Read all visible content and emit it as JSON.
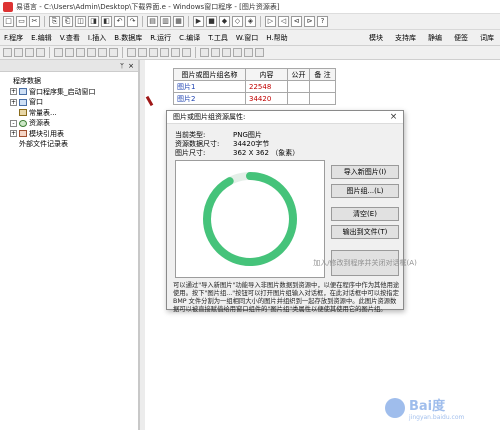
{
  "window": {
    "title": "易语言 - C:\\Users\\Admin\\Desktop\\下载界面.e - Windows窗口程序 - [图片资源表]"
  },
  "toolbar1": {
    "buttons": [
      "□",
      "▭",
      "✂",
      "⎘",
      "⎗",
      "◫",
      "◨",
      "◧",
      "↶",
      "↷",
      "▤",
      "▥",
      "▦",
      "▶",
      "■",
      "◆",
      "◇",
      "◈",
      "▷",
      "◁",
      "⊲",
      "⊳",
      "?"
    ]
  },
  "menubar": {
    "left": [
      "F.程序",
      "E.编辑",
      "V.查看",
      "I.插入",
      "B.数据库",
      "R.运行",
      "C.编译",
      "T.工具",
      "W.窗口",
      "H.帮助"
    ],
    "right": [
      "模块",
      "支持库",
      "静编",
      "便签",
      "词库"
    ]
  },
  "leftpanel": {
    "pin_label": "ᛘ",
    "close_label": "×",
    "tree": [
      {
        "label": "程序数据",
        "expander": "",
        "icon": "",
        "indent": 0
      },
      {
        "label": "窗口程序集_启动窗口",
        "expander": "+",
        "icon": "win",
        "indent": 1
      },
      {
        "label": "窗口",
        "expander": "+",
        "icon": "win",
        "indent": 1
      },
      {
        "label": "常量表...",
        "expander": "",
        "icon": "db",
        "indent": 1
      },
      {
        "label": "资源表",
        "expander": "-",
        "icon": "res",
        "indent": 1
      },
      {
        "label": "模块引用表",
        "expander": "+",
        "icon": "mod",
        "indent": 1
      },
      {
        "label": "外部文件记录表",
        "expander": "",
        "icon": "",
        "indent": 1
      }
    ]
  },
  "resource_table": {
    "headers": [
      "图片或图片组名称",
      "内容",
      "公开",
      "备 注"
    ],
    "rows": [
      {
        "name": "图片1",
        "content": "22548",
        "public": "",
        "note": ""
      },
      {
        "name": "图片2",
        "content": "34420",
        "public": "",
        "note": ""
      }
    ]
  },
  "dialog": {
    "title": "图片或图片组资源属性:",
    "close": "×",
    "info": [
      {
        "label": "当前类型:",
        "value": "PNG图片"
      },
      {
        "label": "资源数据尺寸:",
        "value": "34420字节"
      },
      {
        "label": "图片尺寸:",
        "value": "362 X 362 （象素）"
      }
    ],
    "buttons": {
      "import": "导入新图片(I)",
      "group": "图片组...(L)",
      "clear": "清空(E)",
      "export": "输出到文件(T)",
      "add_to_window": "加入/修改到程序并关闭对话框(A)"
    },
    "description": "可以通过\"导入新图片\"功能导入非图片数据到资源中，以便在程序中作为其他用途使用。按下\"图片组...\"按钮可以打开图片组输入对话框，在此对话框中可以按指定 BMP 文件分割为一组相同大小的图片并组织到一起存放到资源中。此图片资源数据可以被直接赋值给用窗口组件的\"图片组\"类属性以便使其使用它的图片组。",
    "ring": {
      "progress": 0.92,
      "color": "#45c37a",
      "track": "#e4efe8"
    }
  },
  "watermark": {
    "text": "Bai度",
    "sub": "jingyan.baidu.com"
  }
}
